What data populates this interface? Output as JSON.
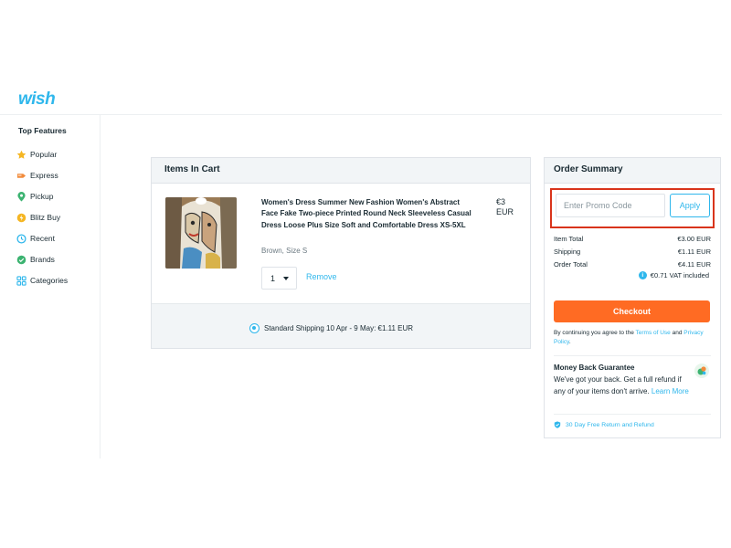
{
  "header": {
    "logo": "wish"
  },
  "sidebar": {
    "title": "Top Features",
    "items": [
      {
        "label": "Popular",
        "icon": "star-icon",
        "color": "#f5b623"
      },
      {
        "label": "Express",
        "icon": "express-icon",
        "color": "#f28b3b"
      },
      {
        "label": "Pickup",
        "icon": "location-icon",
        "color": "#3cb371"
      },
      {
        "label": "Blitz Buy",
        "icon": "coin-icon",
        "color": "#f5b623"
      },
      {
        "label": "Recent",
        "icon": "clock-icon",
        "color": "#2fb7ec"
      },
      {
        "label": "Brands",
        "icon": "badge-check-icon",
        "color": "#3cb371"
      },
      {
        "label": "Categories",
        "icon": "grid-icon",
        "color": "#2fb7ec"
      }
    ]
  },
  "cart": {
    "title": "Items In Cart",
    "item": {
      "title": "Women's Dress Summer New Fashion Women's Abstract Face Fake Two-piece Printed Round Neck Sleeveless Casual Dress Loose Plus Size Soft and Comfortable Dress XS-5XL",
      "variant": "Brown, Size S",
      "price_line1": "€3",
      "price_line2": "EUR",
      "quantity": "1",
      "remove_label": "Remove"
    },
    "shipping": "Standard Shipping 10 Apr - 9 May: €1.11 EUR"
  },
  "summary": {
    "title": "Order Summary",
    "promo_placeholder": "Enter Promo Code",
    "apply_label": "Apply",
    "lines": [
      {
        "label": "Item Total",
        "value": "€3.00 EUR"
      },
      {
        "label": "Shipping",
        "value": "€1.11 EUR"
      },
      {
        "label": "Order Total",
        "value": "€4.11 EUR"
      }
    ],
    "vat": "€0.71 VAT included",
    "checkout_label": "Checkout",
    "terms_prefix": "By continuing you agree to the ",
    "terms_link": "Terms of Use",
    "terms_and": " and ",
    "privacy_link": "Privacy Policy",
    "terms_suffix": ".",
    "guarantee_title": "Money Back Guarantee",
    "guarantee_text": "We've got your back. Get a full refund if any of your items don't arrive. ",
    "learn_more": "Learn More",
    "refund_label": "30 Day Free Return and Refund"
  },
  "colors": {
    "brand": "#2fb7ec",
    "checkout": "#ff6b23",
    "highlight": "#d9341b"
  }
}
